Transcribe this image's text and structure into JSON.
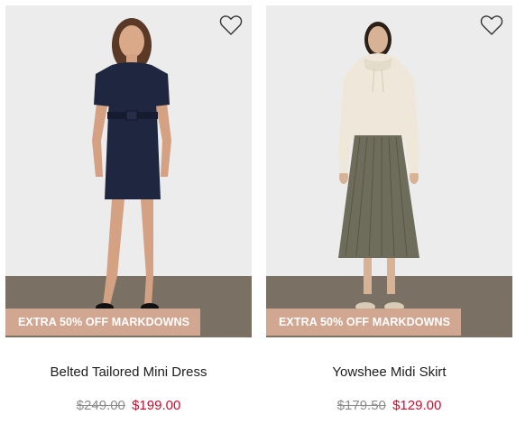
{
  "colors": {
    "wall": "#ececec",
    "floor": "#7b7064",
    "badge_bg": "#d2a791",
    "old_price": "#8c8c8c",
    "sale_price": "#c8102e"
  },
  "products": [
    {
      "name": "Belted Tailored Mini Dress",
      "badge": "EXTRA 50% OFF MARKDOWNS",
      "original_price": "$249.00",
      "sale_price": "$199.00",
      "favorite_icon": "heart-outline-icon",
      "image": "model-in-navy-belted-mini-dress"
    },
    {
      "name": "Yowshee Midi Skirt",
      "badge": "EXTRA 50% OFF MARKDOWNS",
      "original_price": "$179.50",
      "sale_price": "$129.00",
      "favorite_icon": "heart-outline-icon",
      "image": "model-in-cream-hoodie-and-olive-pleated-skirt"
    }
  ]
}
